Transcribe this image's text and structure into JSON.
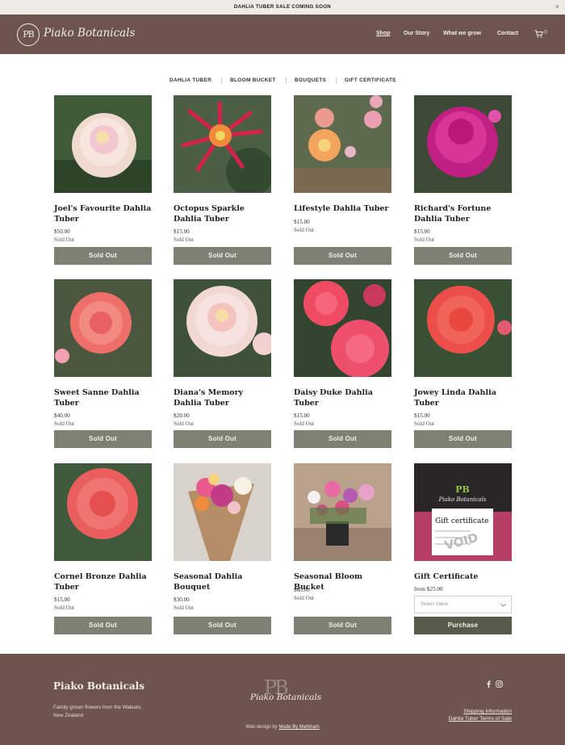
{
  "announcement": {
    "text": "DAHLIA TUBER SALE COMING SOON",
    "close": "×"
  },
  "header": {
    "logo_monogram": "PB",
    "logo_text": "Piako Botanicals",
    "nav": [
      {
        "label": "Shop",
        "active": true
      },
      {
        "label": "Our Story"
      },
      {
        "label": "What we grow"
      },
      {
        "label": "Contact"
      }
    ],
    "cart_count": "0"
  },
  "categories": [
    "DAHLIA TUBER",
    "BLOOM BUCKET",
    "BOUQUETS",
    "GIFT CERTIFICATE"
  ],
  "products": [
    {
      "name": "Joel's Favourite Dahlia Tuber",
      "price": "$50.00",
      "status": "Sold Out",
      "button": "Sold Out"
    },
    {
      "name": "Octopus Sparkle Dahlia Tuber",
      "price": "$15.00",
      "status": "Sold Out",
      "button": "Sold Out"
    },
    {
      "name": "Lifestyle Dahlia Tuber",
      "price": "$15.00",
      "status": "Sold Out",
      "button": "Sold Out"
    },
    {
      "name": "Richard's Fortune Dahlia Tuber",
      "price": "$15.00",
      "status": "Sold Out",
      "button": "Sold Out"
    },
    {
      "name": "Sweet Sanne Dahlia Tuber",
      "price": "$40.00",
      "status": "Sold Out",
      "button": "Sold Out"
    },
    {
      "name": "Diana's Memory Dahlia Tuber",
      "price": "$20.00",
      "status": "Sold Out",
      "button": "Sold Out"
    },
    {
      "name": "Daisy Duke Dahlia Tuber",
      "price": "$15.00",
      "status": "Sold Out",
      "button": "Sold Out"
    },
    {
      "name": "Jowey Linda Dahlia Tuber",
      "price": "$15.00",
      "status": "Sold Out",
      "button": "Sold Out"
    },
    {
      "name": "Cornel Bronze Dahlia Tuber",
      "price": "$15.00",
      "status": "Sold Out",
      "button": "Sold Out"
    },
    {
      "name": "Seasonal Dahlia Bouquet",
      "price": "$30.00",
      "status": "Sold Out",
      "button": "Sold Out"
    },
    {
      "name": "Seasonal Bloom Bucket",
      "price": "$60.00",
      "status": "Sold Out",
      "button": "Sold Out"
    },
    {
      "name": "Gift Certificate",
      "price": "from $25.00",
      "select_placeholder": "Select Value",
      "button": "Purchase"
    }
  ],
  "gift_image": {
    "brand": "Piako Botanicals",
    "heading": "Gift certificate",
    "stamp": "VOID"
  },
  "footer": {
    "title": "Piako Botanicals",
    "description": "Family grown flowers from the Waikato, New Zealand",
    "logo_monogram": "PB",
    "logo_text": "Piako Botanicals",
    "credit_prefix": "Web design by ",
    "credit_link": "Made By Markham",
    "links": [
      "Shipping Information",
      "Dahlia Tuber Terms of Sale"
    ]
  },
  "colors": {
    "header_bg": "#6e544f",
    "announcement_bg": "#efebe6",
    "button_bg": "#7e8073",
    "purchase_bg": "#585a4b"
  }
}
